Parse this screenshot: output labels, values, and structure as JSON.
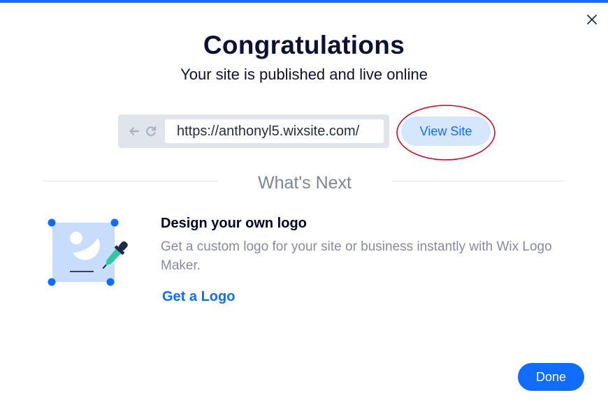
{
  "header": {
    "title": "Congratulations",
    "subtitle": "Your site is published and live online"
  },
  "browser_preview": {
    "url": "https://anthonyl5.wixsite.com/",
    "back_icon": "arrow-left-icon",
    "refresh_icon": "refresh-icon"
  },
  "actions": {
    "view_site_label": "View Site",
    "done_label": "Done",
    "close_icon": "close-icon"
  },
  "section": {
    "title": "What's Next"
  },
  "suggestion": {
    "heading": "Design your own logo",
    "description": "Get a custom logo for your site or business instantly with Wix Logo Maker.",
    "link_label": "Get a Logo",
    "illustration": "logo-maker-illustration"
  },
  "colors": {
    "accent": "#116dff",
    "accent_light": "#d6e6fe",
    "heading": "#0b1233",
    "muted": "#868aa5",
    "highlight_ring": "#d0021b"
  }
}
